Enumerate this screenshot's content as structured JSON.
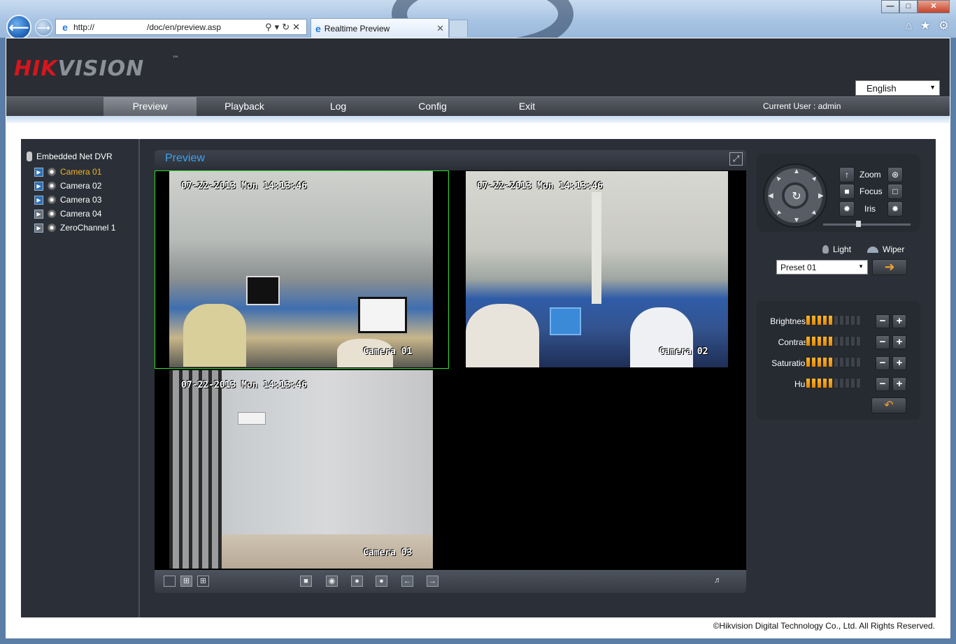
{
  "browser": {
    "address_start": "http://",
    "address_path": "/doc/en/preview.asp",
    "tab_title": "Realtime Preview"
  },
  "header": {
    "logo_hik": "HIK",
    "logo_vision": "VISION",
    "logo_tm": "™",
    "language": "English"
  },
  "menu": {
    "items": [
      "Preview",
      "Playback",
      "Log",
      "Config",
      "Exit"
    ],
    "active": "Preview",
    "current_user": "Current User : admin"
  },
  "tree": {
    "root": "Embedded Net DVR",
    "items": [
      {
        "label": "Camera 01",
        "selected": true,
        "playing": true
      },
      {
        "label": "Camera 02",
        "selected": false,
        "playing": true
      },
      {
        "label": "Camera 03",
        "selected": false,
        "playing": true
      },
      {
        "label": "Camera 04",
        "selected": false,
        "playing": false
      },
      {
        "label": "ZeroChannel 1",
        "selected": false,
        "playing": false
      }
    ]
  },
  "preview": {
    "title": "Preview",
    "cells": [
      {
        "timestamp": "07-22-2013 Mon 14:13:46",
        "name": "Camera 01"
      },
      {
        "timestamp": "07-22-2013 Mon 14:13:46",
        "name": "Camera 02"
      },
      {
        "timestamp": "07-22-2013 Mon 14:13:46",
        "name": "Camera 03"
      }
    ]
  },
  "ptz": {
    "zoom": "Zoom",
    "focus": "Focus",
    "iris": "Iris",
    "light": "Light",
    "wiper": "Wiper",
    "preset": "Preset 01",
    "speed_fraction": 0.4
  },
  "image": {
    "rows": [
      {
        "label": "Brightness",
        "level": 5,
        "max": 10
      },
      {
        "label": "Contrast",
        "level": 5,
        "max": 10
      },
      {
        "label": "Saturation",
        "level": 5,
        "max": 10
      },
      {
        "label": "Hue",
        "level": 5,
        "max": 10
      }
    ]
  },
  "footer": "©Hikvision Digital Technology Co., Ltd. All Rights Reserved.",
  "colors": {
    "accent_blue": "#3ea2f2",
    "selected_yellow": "#f5b21b",
    "level_orange": "#ffb52b",
    "logo_red": "#d5161c"
  }
}
